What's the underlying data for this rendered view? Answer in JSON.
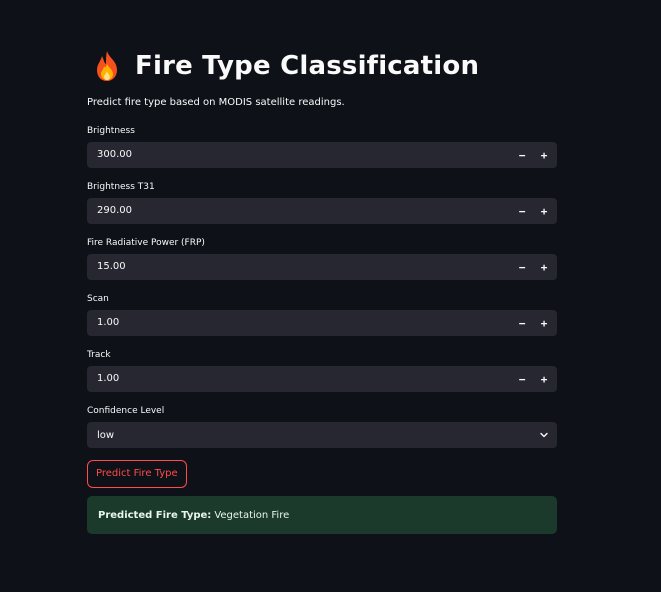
{
  "header": {
    "title": "Fire Type Classification",
    "icon": "flame-icon"
  },
  "subtitle": "Predict fire type based on MODIS satellite readings.",
  "fields": [
    {
      "label": "Brightness",
      "value": "300.00",
      "minus": "−",
      "plus": "+"
    },
    {
      "label": "Brightness T31",
      "value": "290.00",
      "minus": "−",
      "plus": "+"
    },
    {
      "label": "Fire Radiative Power (FRP)",
      "value": "15.00",
      "minus": "−",
      "plus": "+"
    },
    {
      "label": "Scan",
      "value": "1.00",
      "minus": "−",
      "plus": "+"
    },
    {
      "label": "Track",
      "value": "1.00",
      "minus": "−",
      "plus": "+"
    }
  ],
  "confidence": {
    "label": "Confidence Level",
    "selected": "low"
  },
  "predict_button": "Predict Fire Type",
  "result": {
    "label": "Predicted Fire Type:",
    "value": "Vegetation Fire"
  },
  "colors": {
    "background": "#0e1117",
    "input_bg": "#262730",
    "accent": "#ff4b4b",
    "success_bg": "#1b3a2b"
  }
}
